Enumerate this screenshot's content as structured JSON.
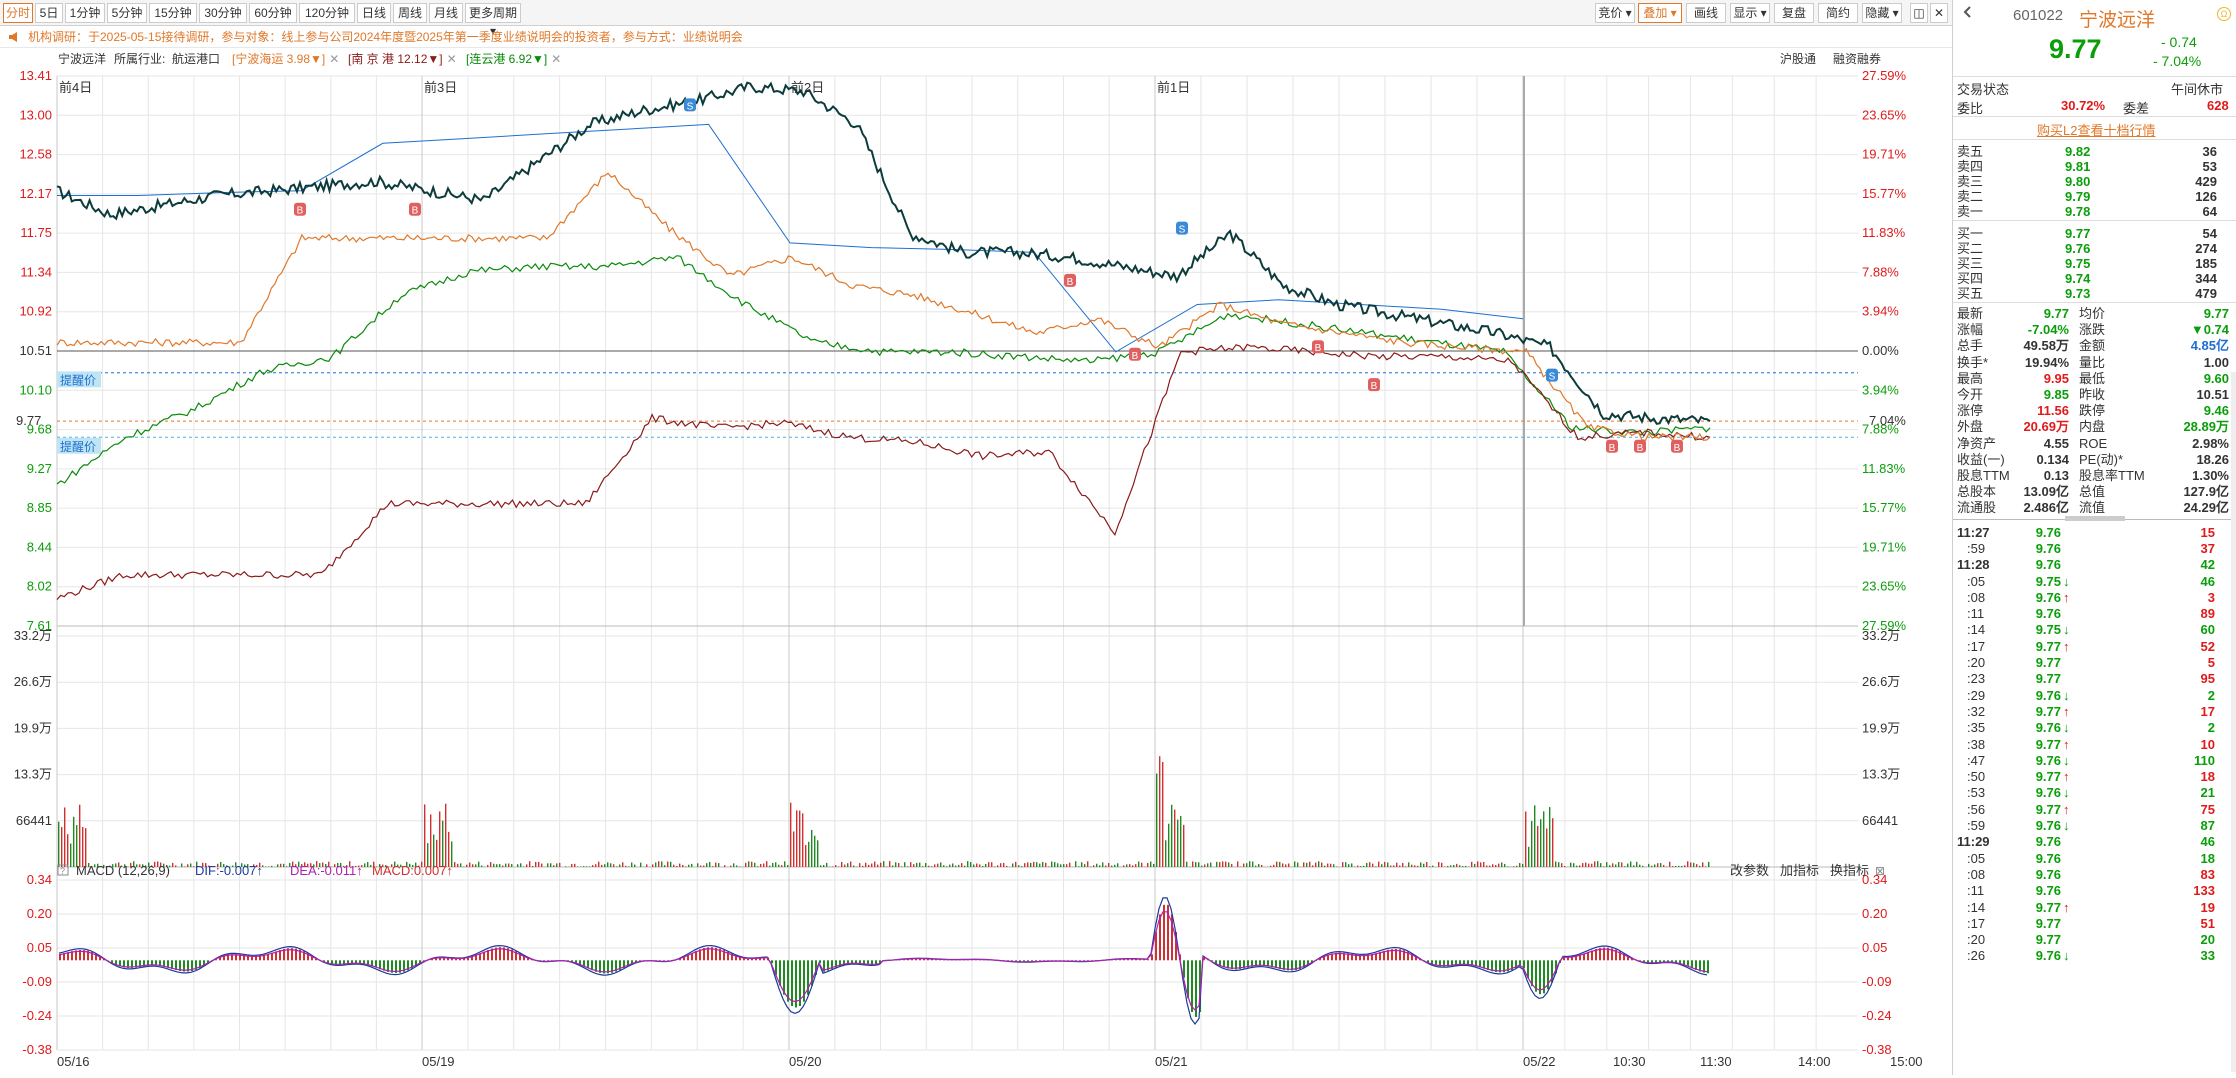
{
  "toolbar": {
    "period_tabs": [
      "分时",
      "5日",
      "1分钟",
      "5分钟",
      "15分钟",
      "30分钟",
      "60分钟",
      "120分钟",
      "日线",
      "周线",
      "月线",
      "更多周期"
    ],
    "right_tools": [
      "竞价",
      "叠加",
      "画线",
      "显示",
      "复盘",
      "简约",
      "隐藏"
    ]
  },
  "notice": {
    "text": "机构调研：于2025-05-15接待调研，参与对象：线上参与公司2024年度暨2025年第一季度业绩说明会的投资者，参与方式：业绩说明会"
  },
  "infobar": {
    "stock": "宁波远洋",
    "industry_label": "所属行业:",
    "industry": "航运港口",
    "compare": [
      {
        "name": "宁波海运",
        "value": "3.98▼",
        "color": "#e0782a"
      },
      {
        "name": "南 京 港",
        "value": "12.12▼",
        "color": "#8b1a1a"
      },
      {
        "name": "连云港",
        "value": "6.92▼",
        "color": "#0a8a0a"
      }
    ],
    "right_links": [
      "沪股通",
      "融资融券"
    ]
  },
  "chart_data": {
    "type": "line",
    "title": "",
    "days": [
      "前4日",
      "前3日",
      "前2日",
      "前1日"
    ],
    "date_labels": [
      "05/16",
      "05/19",
      "05/20",
      "05/21",
      "05/22",
      "10:30",
      "11:30",
      "14:00",
      "15:00"
    ],
    "price_ticks": [
      "13.41",
      "13.00",
      "12.58",
      "12.17",
      "11.75",
      "11.34",
      "10.92",
      "10.51",
      "10.10",
      "9.68",
      "9.27",
      "8.85",
      "8.44",
      "8.02",
      "7.61"
    ],
    "pct_ticks": [
      "27.59%",
      "23.65%",
      "19.71%",
      "15.77%",
      "11.83%",
      "7.88%",
      "3.94%",
      "0.00%",
      "3.94%",
      "7.88%",
      "11.83%",
      "15.77%",
      "19.71%",
      "23.65%",
      "27.59%"
    ],
    "vol_ticks": [
      "33.2万",
      "26.6万",
      "19.9万",
      "13.3万",
      "66441"
    ],
    "macd_ticks": [
      "0.34",
      "0.20",
      "0.05",
      "-0.09",
      "-0.24",
      "-0.38"
    ],
    "current_price": "9.77",
    "current_pct": "7.04%",
    "alert_label": "提醒价",
    "ylim": [
      7.61,
      13.41
    ],
    "prev_close": 10.51,
    "series": [
      {
        "name": "宁波远洋",
        "color": "#0d3b3b",
        "values": [
          12.2,
          11.95,
          12.05,
          12.15,
          12.2,
          12.25,
          12.3,
          12.2,
          12.1,
          12.5,
          12.9,
          13.05,
          13.15,
          13.3,
          13.25,
          12.9,
          11.75,
          11.55,
          11.55,
          11.5,
          11.4,
          11.3,
          11.75,
          11.2,
          11.0,
          10.9,
          10.8,
          10.7,
          10.55,
          9.85,
          9.8,
          9.77
        ]
      },
      {
        "name": "宁波海运",
        "color": "#e0782a",
        "values": [
          10.6,
          10.6,
          10.6,
          10.6,
          11.7,
          11.7,
          11.7,
          11.7,
          11.7,
          12.4,
          11.8,
          11.3,
          11.5,
          11.2,
          11.1,
          10.9,
          10.7,
          10.85,
          10.55,
          11.0,
          10.8,
          10.7,
          10.6,
          10.55,
          10.5,
          9.7,
          9.6,
          9.6
        ]
      },
      {
        "name": "南 京 港",
        "color": "#8b1a1a",
        "values": [
          7.9,
          8.15,
          8.15,
          8.15,
          8.15,
          8.9,
          8.9,
          8.9,
          8.9,
          9.8,
          9.7,
          9.75,
          9.6,
          9.55,
          9.4,
          9.45,
          8.6,
          10.5,
          10.55,
          10.5,
          10.45,
          10.45,
          10.4,
          9.6,
          9.65,
          9.6
        ]
      },
      {
        "name": "连云港",
        "color": "#0a8a0a",
        "values": [
          9.1,
          9.6,
          9.9,
          10.3,
          10.45,
          11.1,
          11.35,
          11.4,
          11.4,
          11.5,
          11.0,
          10.6,
          10.5,
          10.5,
          10.45,
          10.4,
          10.5,
          10.9,
          10.8,
          10.7,
          10.6,
          10.5,
          9.7,
          9.65,
          9.7
        ]
      }
    ],
    "macd": {
      "label": "MACD (12,26,9)",
      "dif": "DIF:-0.007",
      "dea": "DEA:-0.011",
      "macd": "MACD:0.007"
    },
    "macd_tools": [
      "改参数",
      "加指标",
      "换指标"
    ]
  },
  "quote": {
    "code": "601022",
    "name": "宁波远洋",
    "price": "9.77",
    "change": "- 0.74",
    "change_pct": "- 7.04%",
    "status_label": "交易状态",
    "status": "午间休市",
    "weibi_label": "委比",
    "weibi": "30.72%",
    "weicha_label": "委差",
    "weicha": "628",
    "l2_link": "购买L2查看十档行情",
    "asks": [
      {
        "label": "卖五",
        "price": "9.82",
        "vol": "36"
      },
      {
        "label": "卖四",
        "price": "9.81",
        "vol": "53"
      },
      {
        "label": "卖三",
        "price": "9.80",
        "vol": "429"
      },
      {
        "label": "卖二",
        "price": "9.79",
        "vol": "126"
      },
      {
        "label": "卖一",
        "price": "9.78",
        "vol": "64"
      }
    ],
    "bids": [
      {
        "label": "买一",
        "price": "9.77",
        "vol": "54"
      },
      {
        "label": "买二",
        "price": "9.76",
        "vol": "274"
      },
      {
        "label": "买三",
        "price": "9.75",
        "vol": "185"
      },
      {
        "label": "买四",
        "price": "9.74",
        "vol": "344"
      },
      {
        "label": "买五",
        "price": "9.73",
        "vol": "479"
      }
    ],
    "stats": [
      [
        "最新",
        "9.77",
        "均价",
        "9.77"
      ],
      [
        "涨幅",
        "-7.04%",
        "涨跌",
        "▼0.74"
      ],
      [
        "总手",
        "49.58万",
        "金额",
        "4.85亿"
      ],
      [
        "换手*",
        "19.94%",
        "量比",
        "1.00"
      ],
      [
        "最高",
        "9.95",
        "最低",
        "9.60"
      ],
      [
        "今开",
        "9.85",
        "昨收",
        "10.51"
      ],
      [
        "涨停",
        "11.56",
        "跌停",
        "9.46"
      ],
      [
        "外盘",
        "20.69万",
        "内盘",
        "28.89万"
      ],
      [
        "净资产",
        "4.55",
        "ROE",
        "2.98%"
      ],
      [
        "收益(一)",
        "0.134",
        "PE(动)*",
        "18.26"
      ],
      [
        "股息TTM",
        "0.13",
        "股息率TTM",
        "1.30%"
      ],
      [
        "总股本",
        "13.09亿",
        "总值",
        "127.9亿"
      ],
      [
        "流通股",
        "2.486亿",
        "流值",
        "24.29亿"
      ]
    ],
    "ticks": [
      {
        "t": "11:27",
        "p": "9.76",
        "d": "",
        "v": "15"
      },
      {
        "t": ":59",
        "p": "9.76",
        "d": "",
        "v": "37"
      },
      {
        "t": "11:28",
        "p": "9.76",
        "d": "",
        "v": "42"
      },
      {
        "t": ":05",
        "p": "9.75",
        "d": "↓",
        "v": "46"
      },
      {
        "t": ":08",
        "p": "9.76",
        "d": "↑",
        "v": "3"
      },
      {
        "t": ":11",
        "p": "9.76",
        "d": "",
        "v": "89"
      },
      {
        "t": ":14",
        "p": "9.75",
        "d": "↓",
        "v": "60"
      },
      {
        "t": ":17",
        "p": "9.77",
        "d": "↑",
        "v": "52"
      },
      {
        "t": ":20",
        "p": "9.77",
        "d": "",
        "v": "5"
      },
      {
        "t": ":23",
        "p": "9.77",
        "d": "",
        "v": "95"
      },
      {
        "t": ":29",
        "p": "9.76",
        "d": "↓",
        "v": "2"
      },
      {
        "t": ":32",
        "p": "9.77",
        "d": "↑",
        "v": "17"
      },
      {
        "t": ":35",
        "p": "9.76",
        "d": "↓",
        "v": "2"
      },
      {
        "t": ":38",
        "p": "9.77",
        "d": "↑",
        "v": "10"
      },
      {
        "t": ":47",
        "p": "9.76",
        "d": "↓",
        "v": "110"
      },
      {
        "t": ":50",
        "p": "9.77",
        "d": "↑",
        "v": "18"
      },
      {
        "t": ":53",
        "p": "9.76",
        "d": "↓",
        "v": "21"
      },
      {
        "t": ":56",
        "p": "9.77",
        "d": "↑",
        "v": "75"
      },
      {
        "t": ":59",
        "p": "9.76",
        "d": "↓",
        "v": "87"
      },
      {
        "t": "11:29",
        "p": "9.76",
        "d": "",
        "v": "46"
      },
      {
        "t": ":05",
        "p": "9.76",
        "d": "",
        "v": "18"
      },
      {
        "t": ":08",
        "p": "9.76",
        "d": "",
        "v": "83"
      },
      {
        "t": ":11",
        "p": "9.76",
        "d": "",
        "v": "133"
      },
      {
        "t": ":14",
        "p": "9.77",
        "d": "↑",
        "v": "19"
      },
      {
        "t": ":17",
        "p": "9.77",
        "d": "",
        "v": "51"
      },
      {
        "t": ":20",
        "p": "9.77",
        "d": "",
        "v": "20"
      },
      {
        "t": ":26",
        "p": "9.76",
        "d": "↓",
        "v": "33"
      }
    ]
  }
}
